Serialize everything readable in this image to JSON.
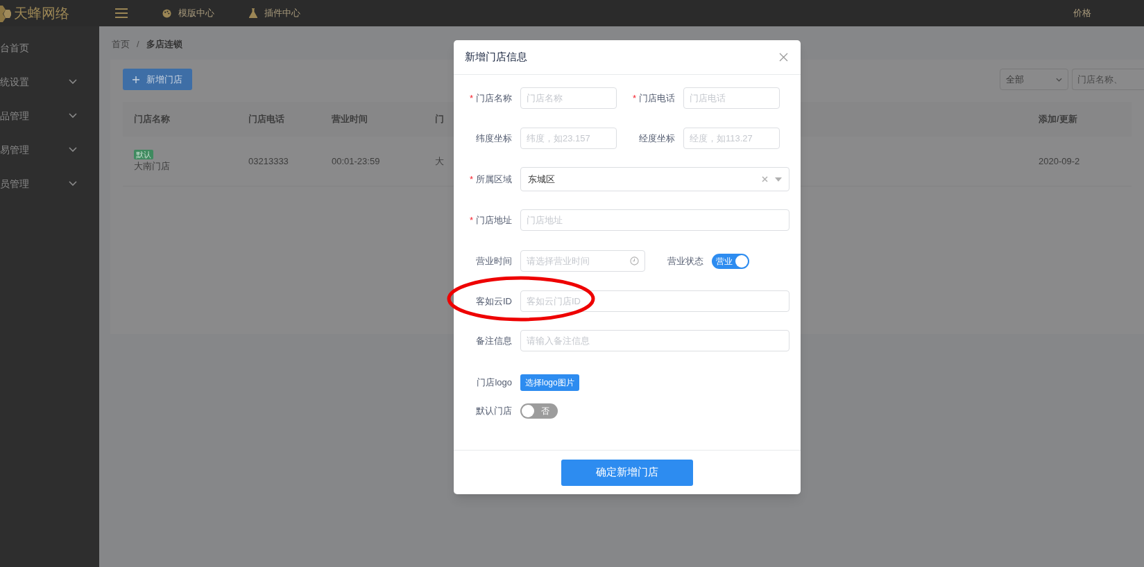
{
  "top_bar": {
    "logo": "天蜂网络",
    "nav": [
      {
        "label": "模版中心",
        "kind": "palette"
      },
      {
        "label": "插件中心",
        "kind": "flask"
      }
    ],
    "right_link": "价格"
  },
  "sidebar": {
    "items": [
      {
        "label": "台首页",
        "kind": "link"
      },
      {
        "label": "统设置",
        "kind": "group"
      },
      {
        "label": "品管理",
        "kind": "group"
      },
      {
        "label": "易管理",
        "kind": "group"
      },
      {
        "label": "员管理",
        "kind": "group"
      }
    ]
  },
  "breadcrumb": [
    {
      "label": "首页",
      "selected": false
    },
    {
      "separator": "/",
      "label": "多店连锁",
      "selected": true
    }
  ],
  "add_button": "新增门店",
  "filter": {
    "value": "全部"
  },
  "search": {
    "placeholder": "门店名称、"
  },
  "table": {
    "columns": [
      "门店名称",
      "门店电话",
      "营业时间",
      "门",
      "添加/更新"
    ],
    "rows": [
      {
        "tag": "默认",
        "cells": [
          "大南门店",
          "03213333",
          "00:01-23:59",
          "大",
          "2020-09-2"
        ]
      }
    ]
  },
  "dialog": {
    "title": "新增门店信息",
    "rows": [
      [
        {
          "kind": "input",
          "label": "门店名称",
          "required_mark": "*",
          "placeholder": "门店名称"
        },
        {
          "kind": "input",
          "label": "门店电话",
          "required_mark": "*",
          "placeholder": "门店电话"
        }
      ],
      [
        {
          "kind": "input",
          "label": "纬度坐标",
          "placeholder": "纬度，如23.157"
        },
        {
          "kind": "input",
          "label": "经度坐标",
          "placeholder": "经度，如113.27"
        }
      ],
      [
        {
          "kind": "select",
          "label": "所属区域",
          "required_mark": "*",
          "value": "东城区"
        }
      ],
      [
        {
          "kind": "input",
          "label": "门店地址",
          "required_mark": "*",
          "placeholder": "门店地址"
        }
      ],
      [
        {
          "kind": "time",
          "label": "营业时间",
          "placeholder": "请选择营业时间"
        },
        {
          "kind": "switch",
          "label": "营业状态",
          "on": true,
          "text": "营业"
        }
      ],
      [
        {
          "kind": "input",
          "label": "客如云ID",
          "placeholder": "客如云门店ID"
        }
      ],
      [
        {
          "kind": "input",
          "label": "备注信息",
          "placeholder": "请输入备注信息"
        }
      ],
      [
        {
          "kind": "upload",
          "label": "门店logo",
          "button": "选择logo图片"
        }
      ],
      [
        {
          "kind": "switch",
          "label": "默认门店",
          "on": false,
          "text": "否"
        }
      ]
    ],
    "submit_button": "确定新增门店"
  }
}
